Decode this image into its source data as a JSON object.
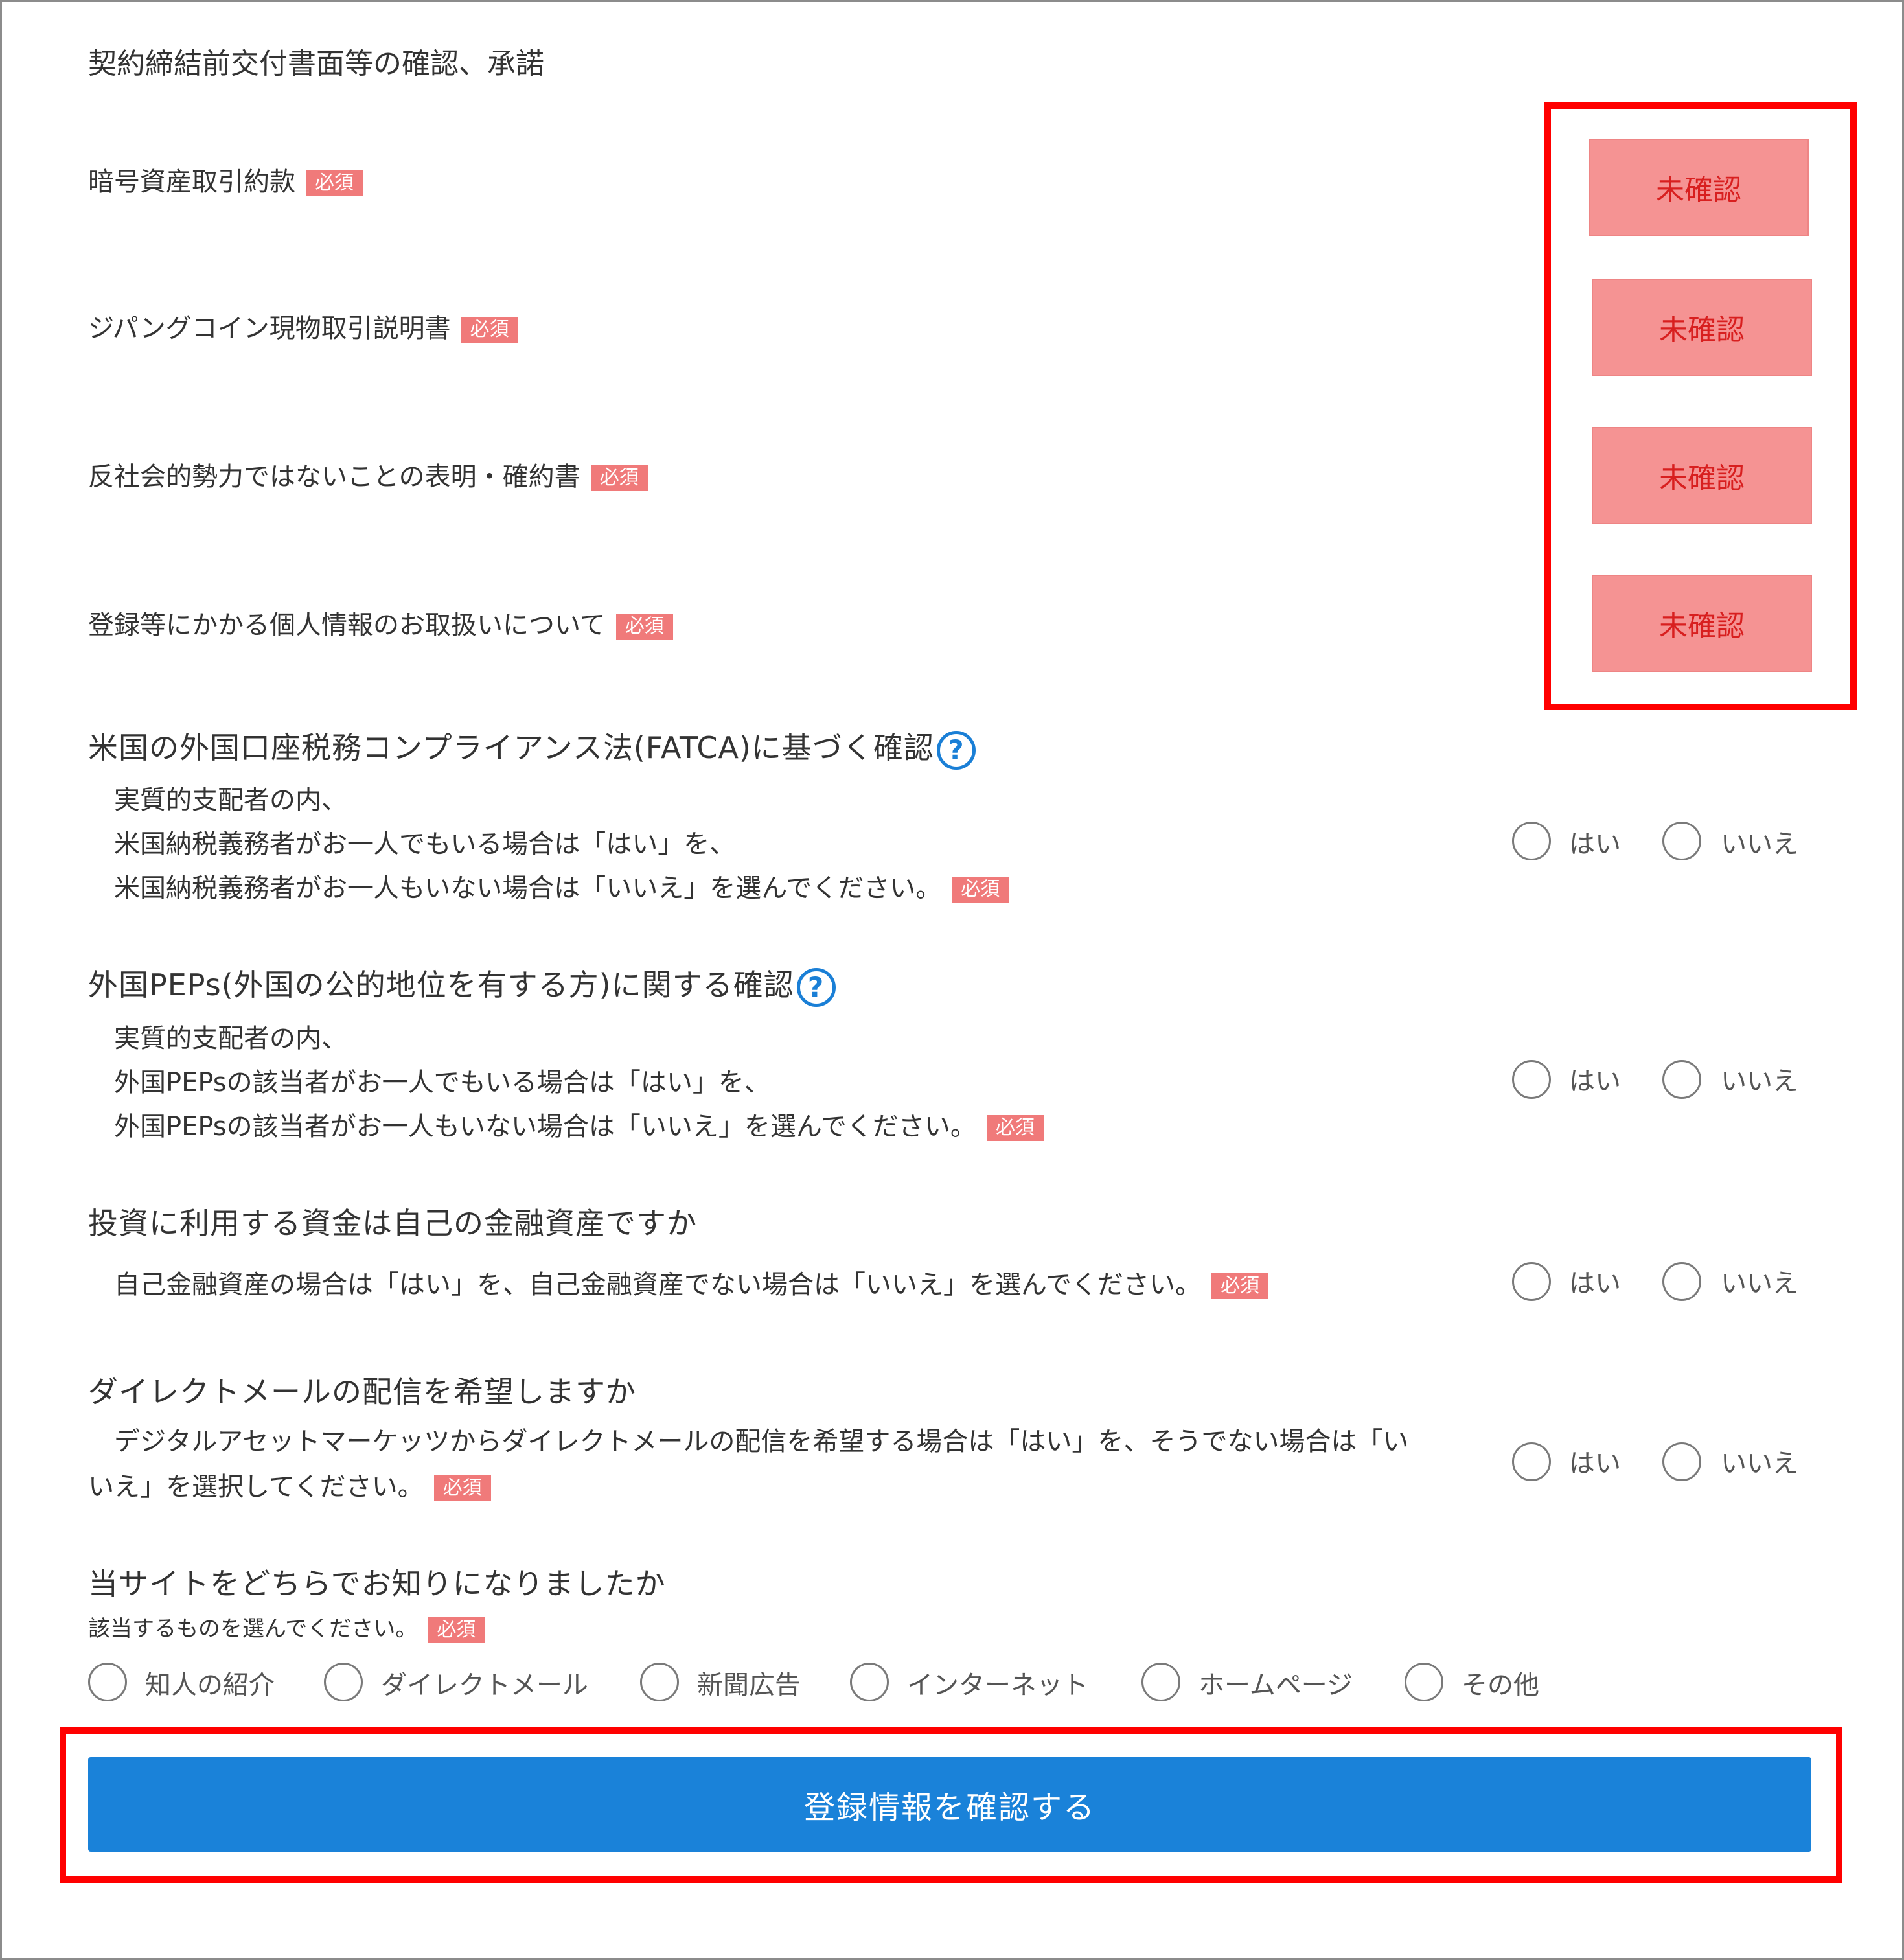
{
  "section_title": "契約締結前交付書面等の確認、承諾",
  "required_badge": "必須",
  "documents": [
    {
      "label": "暗号資産取引約款",
      "button": "未確認"
    },
    {
      "label": "ジパングコイン現物取引説明書",
      "button": "未確認"
    },
    {
      "label": "反社会的勢力ではないことの表明・確約書",
      "button": "未確認"
    },
    {
      "label": "登録等にかかる個人情報のお取扱いについて",
      "button": "未確認"
    }
  ],
  "questions": {
    "fatca": {
      "title": "米国の外国口座税務コンプライアンス法(FATCA)に基づく確認",
      "lines": [
        "実質的支配者の内、",
        "米国納税義務者がお一人でもいる場合は「はい」を、",
        "米国納税義務者がお一人もいない場合は「いいえ」を選んでください。"
      ]
    },
    "peps": {
      "title": "外国PEPs(外国の公的地位を有する方)に関する確認",
      "lines": [
        "実質的支配者の内、",
        "外国PEPsの該当者がお一人でもいる場合は「はい」を、",
        "外国PEPsの該当者がお一人もいない場合は「いいえ」を選んでください。"
      ]
    },
    "funds": {
      "title": "投資に利用する資金は自己の金融資産ですか",
      "lines": [
        "自己金融資産の場合は「はい」を、自己金融資産でない場合は「いいえ」を選んでください。"
      ]
    },
    "dm": {
      "title": "ダイレクトメールの配信を希望しますか",
      "lines": [
        "デジタルアセットマーケッツからダイレクトメールの配信を希望する場合は「はい」を、そうでない場合は「い",
        "いえ」を選択してください。"
      ]
    }
  },
  "yes_label": "はい",
  "no_label": "いいえ",
  "source": {
    "title": "当サイトをどちらでお知りになりましたか",
    "note": "該当するものを選んでください。",
    "options": [
      "知人の紹介",
      "ダイレクトメール",
      "新聞広告",
      "インターネット",
      "ホームページ",
      "その他"
    ]
  },
  "help_icon_symbol": "?",
  "submit_label": "登録情報を確認する",
  "colors": {
    "badge": "#f07a7a",
    "confirm_button_bg": "#f59393",
    "confirm_button_text": "#d81f1f",
    "highlight_border": "#ff0000",
    "submit_bg": "#1a82d9",
    "help_icon": "#1a7fd6"
  }
}
